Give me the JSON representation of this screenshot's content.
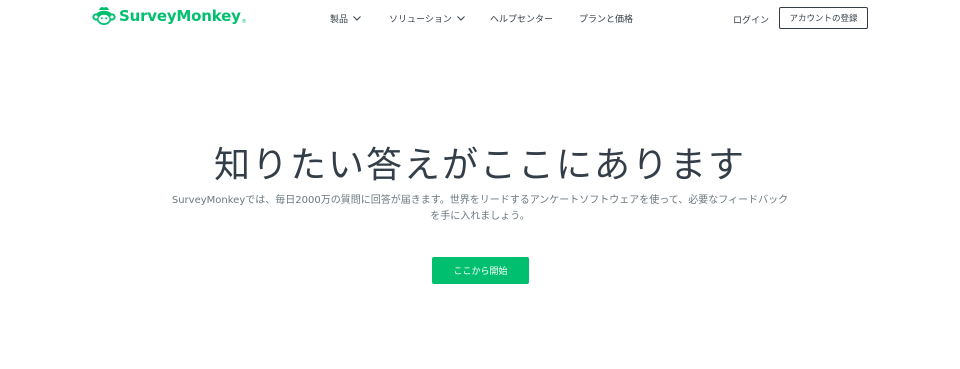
{
  "brand": {
    "name": "SurveyMonkey",
    "trademark": "®",
    "color": "#00bf6f"
  },
  "nav": {
    "items": [
      {
        "label": "製品",
        "has_dropdown": true
      },
      {
        "label": "ソリューション",
        "has_dropdown": true
      },
      {
        "label": "ヘルプセンター",
        "has_dropdown": false
      },
      {
        "label": "プランと価格",
        "has_dropdown": false
      }
    ],
    "login_label": "ログイン",
    "signup_label": "アカウントの登録"
  },
  "hero": {
    "title": "知りたい答えがここにあります",
    "description_line1": "SurveyMonkeyでは、毎日2000万の質問に回答が届きます。世界をリードするアンケートソフトウェアを使って、必要なフィードバック",
    "description_line2": "を手に入れましょう。",
    "cta_label": "ここから開始"
  },
  "colors": {
    "text": "#333e48",
    "muted": "#6b787f",
    "accent": "#00bf6f"
  },
  "icons": {
    "logo": "surveymonkey-logo-icon",
    "dropdown": "chevron-down-icon"
  }
}
